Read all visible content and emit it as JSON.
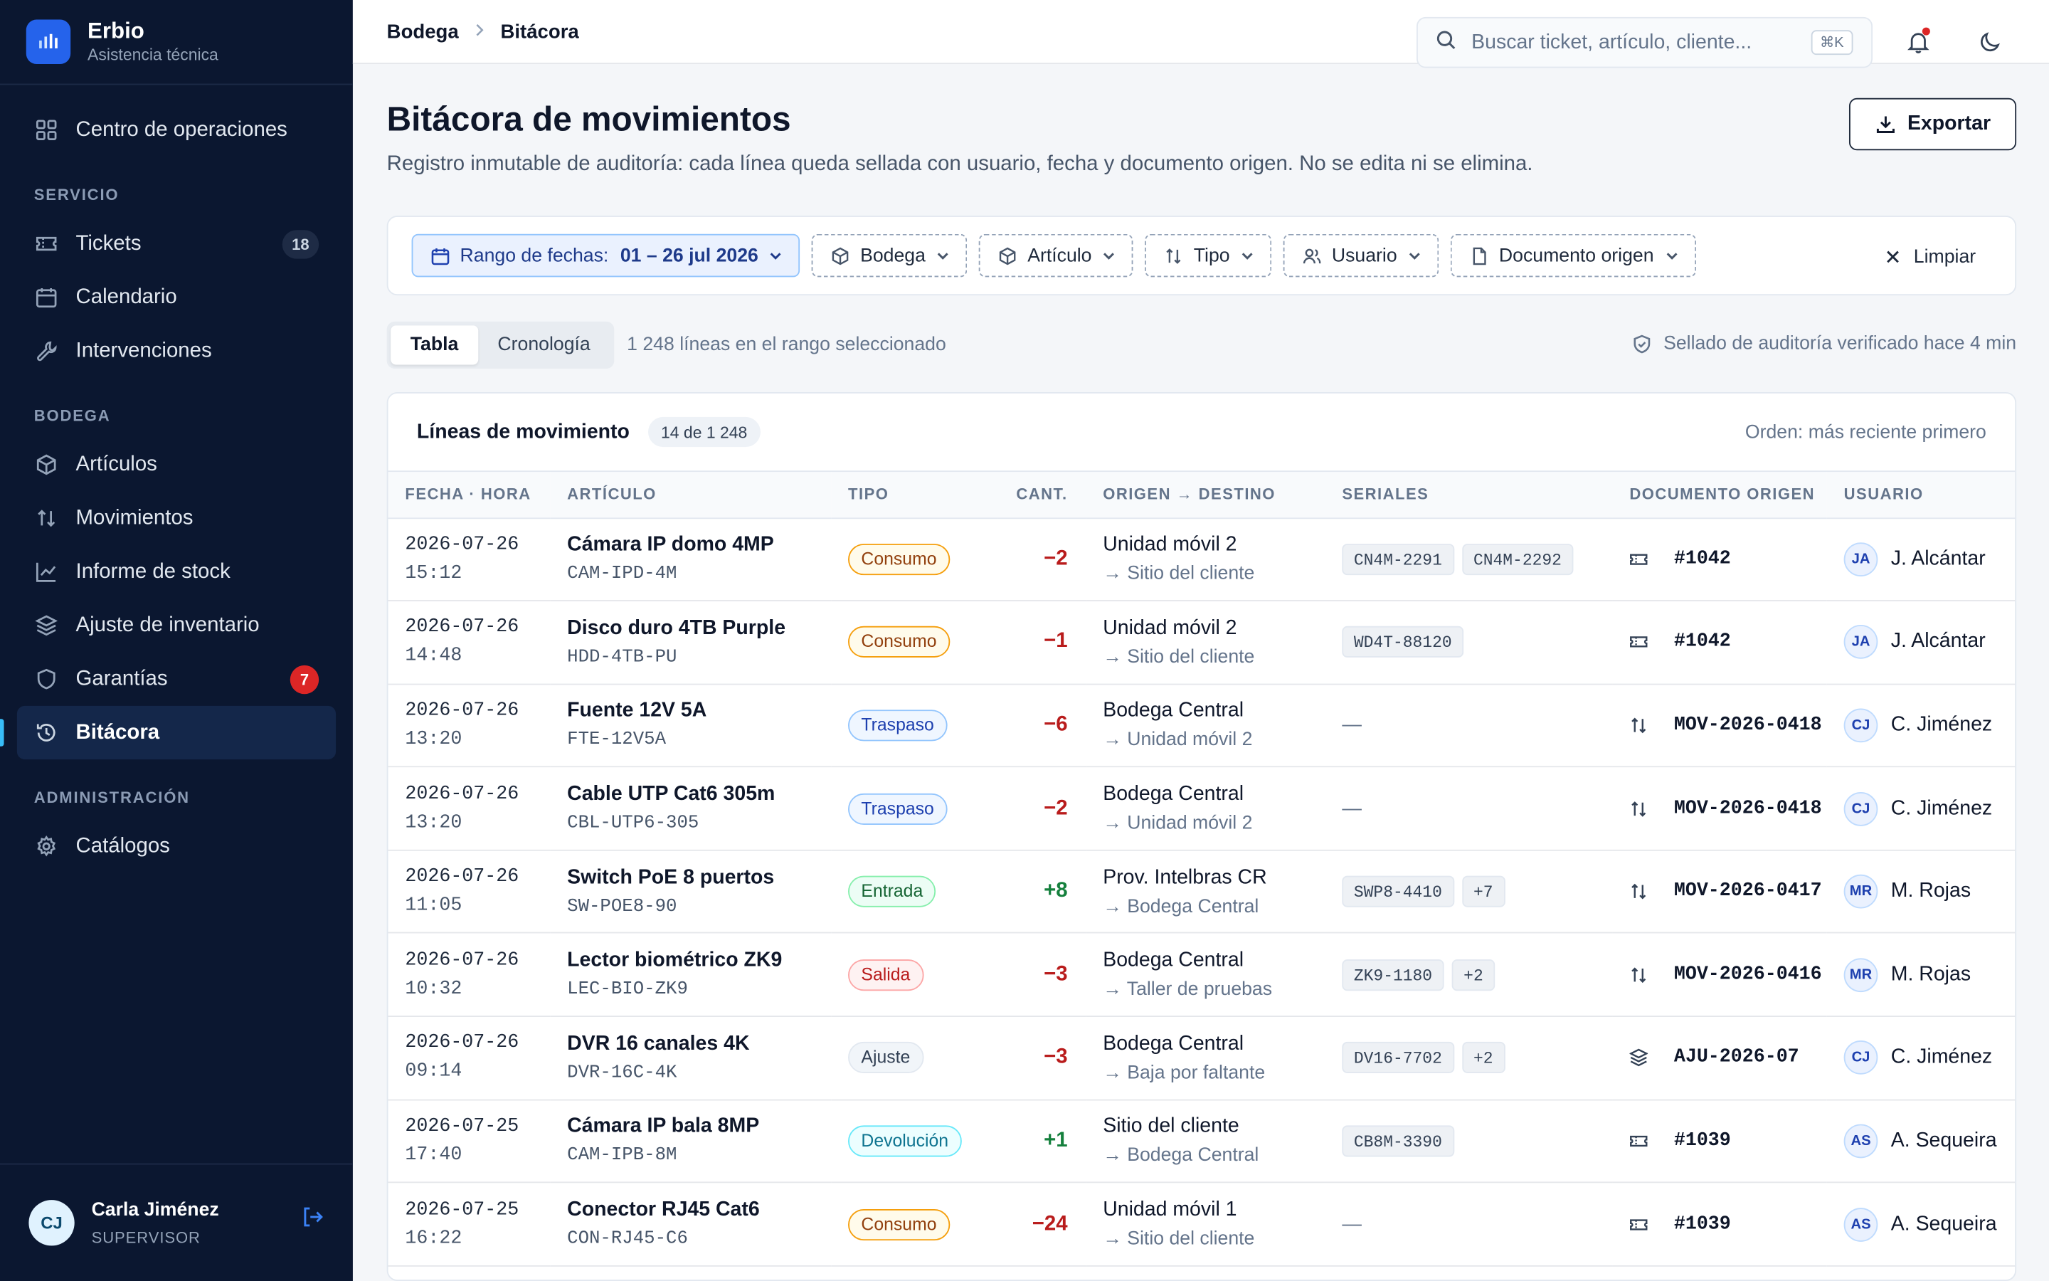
{
  "brand": {
    "name": "Erbio",
    "subtitle": "Asistencia técnica"
  },
  "sidebar": {
    "top": [
      {
        "label": "Centro de operaciones",
        "icon": "grid-icon"
      }
    ],
    "sections": [
      {
        "label": "SERVICIO",
        "items": [
          {
            "label": "Tickets",
            "icon": "ticket-icon",
            "badge": "18"
          },
          {
            "label": "Calendario",
            "icon": "calendar-icon"
          },
          {
            "label": "Intervenciones",
            "icon": "wrench-icon"
          }
        ]
      },
      {
        "label": "BODEGA",
        "items": [
          {
            "label": "Artículos",
            "icon": "box-icon"
          },
          {
            "label": "Movimientos",
            "icon": "swap-icon"
          },
          {
            "label": "Informe de stock",
            "icon": "chart-icon"
          },
          {
            "label": "Ajuste de inventario",
            "icon": "layers-icon"
          },
          {
            "label": "Garantías",
            "icon": "shield-icon",
            "badge": "7"
          },
          {
            "label": "Bitácora",
            "icon": "history-icon",
            "active": true
          }
        ]
      },
      {
        "label": "ADMINISTRACIÓN",
        "items": [
          {
            "label": "Catálogos",
            "icon": "gear-icon"
          }
        ]
      }
    ],
    "user": {
      "initials": "CJ",
      "name": "Carla Jiménez",
      "role": "SUPERVISOR"
    }
  },
  "topbar": {
    "breadcrumb": [
      "Bodega",
      "Bitácora"
    ],
    "search_placeholder": "Buscar ticket, artículo, cliente...",
    "search_shortcut": "⌘K"
  },
  "page": {
    "title": "Bitácora de movimientos",
    "description": "Registro inmutable de auditoría: cada línea queda sellada con usuario, fecha y documento origen. No se edita ni se elimina.",
    "export_label": "Exportar"
  },
  "filters": {
    "date_label": "Rango de fechas:",
    "date_value": "01 – 26 jul 2026",
    "chips": [
      "Bodega",
      "Artículo",
      "Tipo",
      "Usuario",
      "Documento origen"
    ],
    "clear_label": "Limpiar"
  },
  "view": {
    "tabs": [
      "Tabla",
      "Cronología"
    ],
    "active_tab": "Tabla",
    "range_info": "1 248 líneas en el rango seleccionado",
    "audit_status": "Sellado de auditoría verificado hace 4 min"
  },
  "table": {
    "title": "Líneas de movimiento",
    "count": "14 de 1 248",
    "order": "Orden: más reciente primero",
    "columns": [
      "FECHA · HORA",
      "ARTÍCULO",
      "TIPO",
      "CANT.",
      "ORIGEN → DESTINO",
      "SERIALES",
      "DOCUMENTO ORIGEN",
      "USUARIO"
    ],
    "rows": [
      {
        "date": "2026-07-26",
        "time": "15:12",
        "name": "Cámara IP domo 4MP",
        "sku": "CAM-IPD-4M",
        "type": "Consumo",
        "type_class": "consumo",
        "qty": "−2",
        "sign": "neg",
        "from": "Unidad móvil 2",
        "to": "→ Sitio del cliente",
        "serials": [
          "CN4M-2291",
          "CN4M-2292"
        ],
        "doc_icon": "ticket-icon",
        "doc": "#1042",
        "user_initials": "JA",
        "user": "J. Alcántar"
      },
      {
        "date": "2026-07-26",
        "time": "14:48",
        "name": "Disco duro 4TB Purple",
        "sku": "HDD-4TB-PU",
        "type": "Consumo",
        "type_class": "consumo",
        "qty": "−1",
        "sign": "neg",
        "from": "Unidad móvil 2",
        "to": "→ Sitio del cliente",
        "serials": [
          "WD4T-88120"
        ],
        "doc_icon": "ticket-icon",
        "doc": "#1042",
        "user_initials": "JA",
        "user": "J. Alcántar"
      },
      {
        "date": "2026-07-26",
        "time": "13:20",
        "name": "Fuente 12V 5A",
        "sku": "FTE-12V5A",
        "type": "Traspaso",
        "type_class": "traspaso",
        "qty": "−6",
        "sign": "neg",
        "from": "Bodega Central",
        "to": "→ Unidad móvil 2",
        "serials": [],
        "doc_icon": "swap-icon",
        "doc": "MOV-2026-0418",
        "user_initials": "CJ",
        "user": "C. Jiménez"
      },
      {
        "date": "2026-07-26",
        "time": "13:20",
        "name": "Cable UTP Cat6 305m",
        "sku": "CBL-UTP6-305",
        "type": "Traspaso",
        "type_class": "traspaso",
        "qty": "−2",
        "sign": "neg",
        "from": "Bodega Central",
        "to": "→ Unidad móvil 2",
        "serials": [],
        "doc_icon": "swap-icon",
        "doc": "MOV-2026-0418",
        "user_initials": "CJ",
        "user": "C. Jiménez"
      },
      {
        "date": "2026-07-26",
        "time": "11:05",
        "name": "Switch PoE 8 puertos",
        "sku": "SW-POE8-90",
        "type": "Entrada",
        "type_class": "entrada",
        "qty": "+8",
        "sign": "pos",
        "from": "Prov. Intelbras CR",
        "to": "→ Bodega Central",
        "serials": [
          "SWP8-4410",
          "+7"
        ],
        "doc_icon": "swap-icon",
        "doc": "MOV-2026-0417",
        "user_initials": "MR",
        "user": "M. Rojas"
      },
      {
        "date": "2026-07-26",
        "time": "10:32",
        "name": "Lector biométrico ZK9",
        "sku": "LEC-BIO-ZK9",
        "type": "Salida",
        "type_class": "salida",
        "qty": "−3",
        "sign": "neg",
        "from": "Bodega Central",
        "to": "→ Taller de pruebas",
        "serials": [
          "ZK9-1180",
          "+2"
        ],
        "doc_icon": "swap-icon",
        "doc": "MOV-2026-0416",
        "user_initials": "MR",
        "user": "M. Rojas"
      },
      {
        "date": "2026-07-26",
        "time": "09:14",
        "name": "DVR 16 canales 4K",
        "sku": "DVR-16C-4K",
        "type": "Ajuste",
        "type_class": "ajuste",
        "qty": "−3",
        "sign": "neg",
        "from": "Bodega Central",
        "to": "→ Baja por faltante",
        "serials": [
          "DV16-7702",
          "+2"
        ],
        "doc_icon": "layers-icon",
        "doc": "AJU-2026-07",
        "user_initials": "CJ",
        "user": "C. Jiménez"
      },
      {
        "date": "2026-07-25",
        "time": "17:40",
        "name": "Cámara IP bala 8MP",
        "sku": "CAM-IPB-8M",
        "type": "Devolución",
        "type_class": "devolucion",
        "qty": "+1",
        "sign": "pos",
        "from": "Sitio del cliente",
        "to": "→ Bodega Central",
        "serials": [
          "CB8M-3390"
        ],
        "doc_icon": "ticket-icon",
        "doc": "#1039",
        "user_initials": "AS",
        "user": "A. Sequeira"
      },
      {
        "date": "2026-07-25",
        "time": "16:22",
        "name": "Conector RJ45 Cat6",
        "sku": "CON-RJ45-C6",
        "type": "Consumo",
        "type_class": "consumo",
        "qty": "−24",
        "sign": "neg",
        "from": "Unidad móvil 1",
        "to": "→ Sitio del cliente",
        "serials": [],
        "doc_icon": "ticket-icon",
        "doc": "#1039",
        "user_initials": "AS",
        "user": "A. Sequeira"
      }
    ]
  }
}
